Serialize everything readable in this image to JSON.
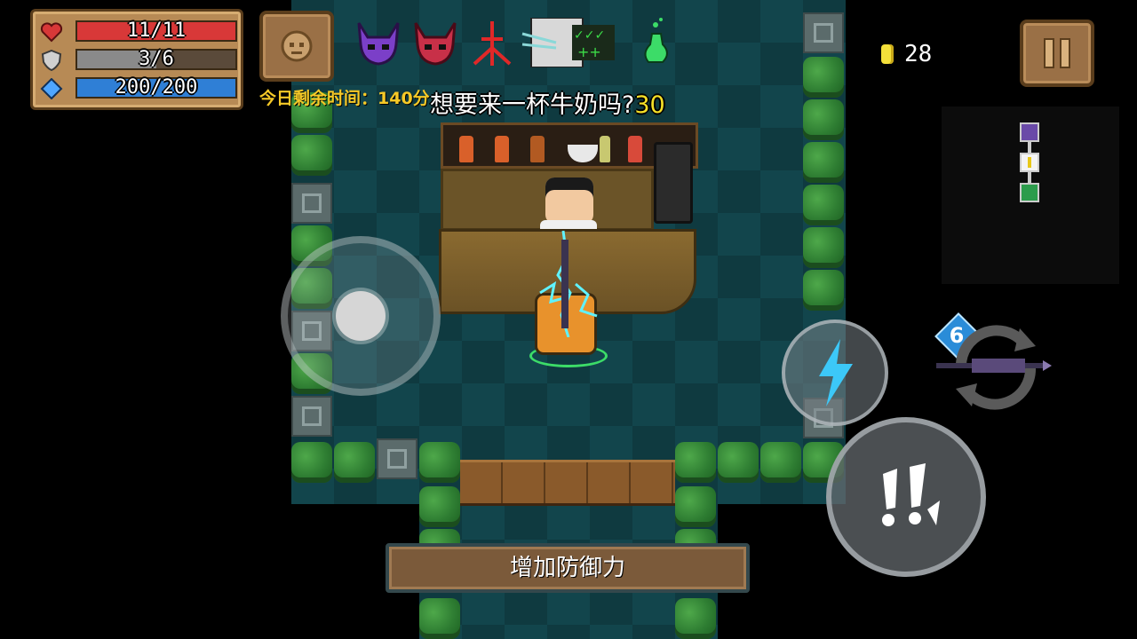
{
  "status": {
    "health": {
      "current": 11,
      "max": 11,
      "text": "11/11",
      "icon": "heart-icon",
      "color": "#d83838"
    },
    "armor": {
      "current": 3,
      "max": 6,
      "text": "3/6",
      "icon": "shield-icon",
      "color": "#8a8a8a"
    },
    "energy": {
      "current": 200,
      "max": 200,
      "text": "200/200",
      "icon": "crystal-icon",
      "color": "#2f7fd6"
    }
  },
  "character_button_icon": "character-face-icon",
  "buffs": [
    {
      "icon": "purple-horned-helmet-icon"
    },
    {
      "icon": "red-horned-helmet-icon"
    },
    {
      "icon": "red-trident-icon"
    },
    {
      "icon": "skeleton-checklist-icon"
    },
    {
      "icon": "green-poison-flask-icon"
    }
  ],
  "timer": {
    "text": "今日剩余时间：140分"
  },
  "npc_speech": {
    "text": "想要来一杯牛奶吗?",
    "count": "30"
  },
  "coins": {
    "value": "28",
    "icon": "gem-coin-icon"
  },
  "pause_button": {
    "icon": "pause-icon"
  },
  "minimap": {
    "rooms": [
      "boss-room-icon",
      "shop-room-icon",
      "start-room-icon"
    ]
  },
  "skill_button": {
    "icon": "lightning-icon"
  },
  "weapon": {
    "energy_cost": "6",
    "icon": "lightning-sword-icon"
  },
  "attack_button": {
    "icon": "attack-icon"
  },
  "hint_banner": {
    "text": "增加防御力"
  },
  "colors": {
    "accent_yellow": "#f6c927",
    "floor": "#0f3a40",
    "wood": "#9a7046"
  }
}
